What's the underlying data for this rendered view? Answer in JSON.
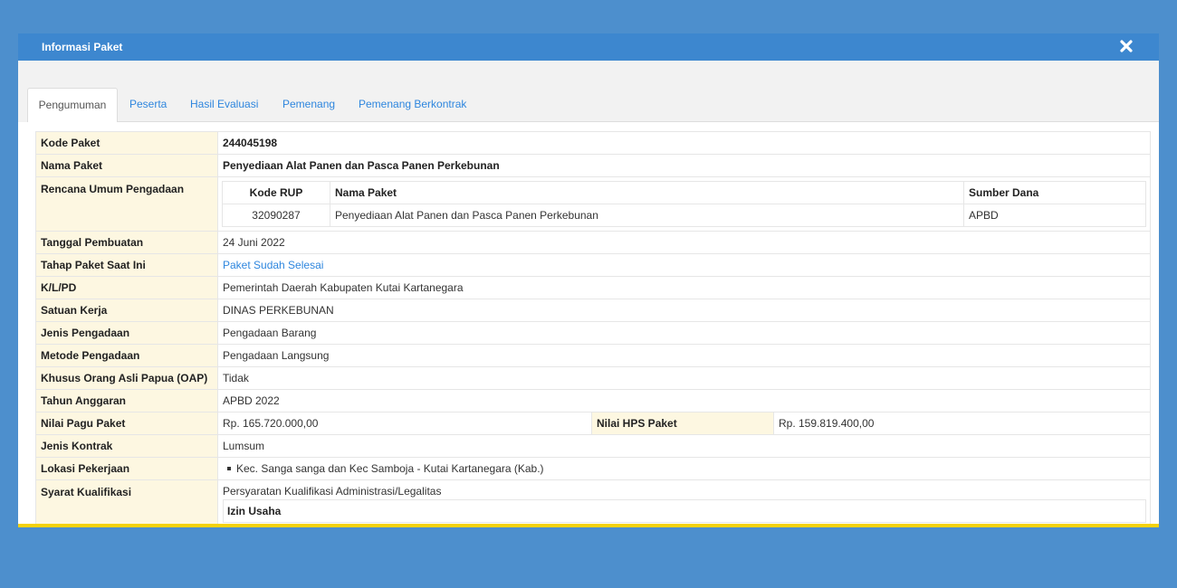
{
  "modal": {
    "title": "Informasi Paket",
    "close_icon": "close-icon"
  },
  "tabs": [
    {
      "label": "Pengumuman",
      "active": true
    },
    {
      "label": "Peserta"
    },
    {
      "label": "Hasil Evaluasi"
    },
    {
      "label": "Pemenang"
    },
    {
      "label": "Pemenang Berkontrak"
    }
  ],
  "info": {
    "kode_paket": {
      "label": "Kode Paket",
      "value": "244045198"
    },
    "nama_paket": {
      "label": "Nama Paket",
      "value": "Penyediaan Alat Panen dan Pasca Panen Perkebunan"
    },
    "rup": {
      "label": "Rencana Umum Pengadaan",
      "headers": [
        "Kode RUP",
        "Nama Paket",
        "Sumber Dana"
      ],
      "rows": [
        [
          "32090287",
          "Penyediaan Alat Panen dan Pasca Panen Perkebunan",
          "APBD"
        ]
      ]
    },
    "tanggal": {
      "label": "Tanggal Pembuatan",
      "value": "24 Juni 2022"
    },
    "tahap": {
      "label": "Tahap Paket Saat Ini",
      "value": "Paket Sudah Selesai"
    },
    "klpd": {
      "label": "K/L/PD",
      "value": "Pemerintah Daerah Kabupaten Kutai Kartanegara"
    },
    "satker": {
      "label": "Satuan Kerja",
      "value": "DINAS PERKEBUNAN"
    },
    "jenis_pengadaan": {
      "label": "Jenis Pengadaan",
      "value": "Pengadaan Barang"
    },
    "metode": {
      "label": "Metode Pengadaan",
      "value": "Pengadaan Langsung"
    },
    "oap": {
      "label": "Khusus Orang Asli Papua (OAP)",
      "value": "Tidak"
    },
    "tahun": {
      "label": "Tahun Anggaran",
      "value": "APBD 2022"
    },
    "pagu": {
      "label": "Nilai Pagu Paket",
      "value": "Rp. 165.720.000,00"
    },
    "hps": {
      "label": "Nilai HPS Paket",
      "value": "Rp. 159.819.400,00"
    },
    "kontrak": {
      "label": "Jenis Kontrak",
      "value": "Lumsum"
    },
    "lokasi": {
      "label": "Lokasi Pekerjaan",
      "value": "Kec. Sanga sanga dan Kec Samboja - Kutai Kartanegara (Kab.)"
    },
    "syarat": {
      "label": "Syarat Kualifikasi",
      "heading": "Persyaratan Kualifikasi Administrasi/Legalitas",
      "sub": "Izin Usaha"
    }
  }
}
